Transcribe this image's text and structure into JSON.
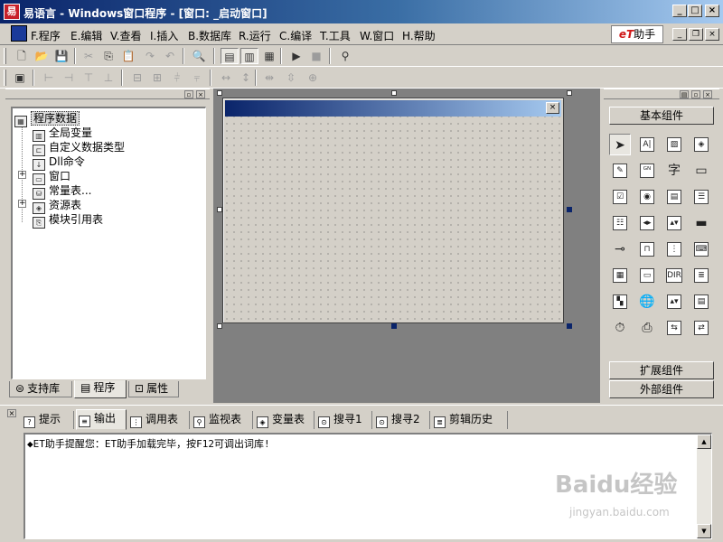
{
  "window": {
    "app_icon": "易",
    "title": "易语言 - Windows窗口程序 - [窗口: _启动窗口]",
    "controls": [
      "_",
      "□",
      "×"
    ]
  },
  "menubar": {
    "items": [
      "F.程序",
      "E.编辑",
      "V.查看",
      "I.插入",
      "B.数据库",
      "R.运行",
      "C.编译",
      "T.工具",
      "W.窗口",
      "H.帮助"
    ],
    "et_logo_prefix": "eT",
    "et_logo_text": "助手",
    "mdi_controls": [
      "_",
      "❐",
      "×"
    ]
  },
  "toolbar1": {
    "buttons": [
      {
        "icon": "new-file-icon",
        "glyph": "🗋",
        "state": "normal"
      },
      {
        "icon": "open-folder-icon",
        "glyph": "📂",
        "state": "normal"
      },
      {
        "icon": "save-icon",
        "glyph": "💾",
        "state": "normal"
      },
      {
        "icon": "cut-icon",
        "glyph": "✂",
        "state": "disabled"
      },
      {
        "icon": "copy-icon",
        "glyph": "⎘",
        "state": "normal"
      },
      {
        "icon": "paste-icon",
        "glyph": "📋",
        "state": "normal"
      },
      {
        "icon": "redo-icon",
        "glyph": "↷",
        "state": "disabled"
      },
      {
        "icon": "undo-icon",
        "glyph": "↶",
        "state": "disabled"
      },
      {
        "icon": "find-icon",
        "glyph": "🔍",
        "state": "normal"
      },
      {
        "icon": "layout-1-icon",
        "glyph": "▤",
        "state": "pressed"
      },
      {
        "icon": "layout-2-icon",
        "glyph": "▥",
        "state": "pressed"
      },
      {
        "icon": "layout-3-icon",
        "glyph": "▦",
        "state": "normal"
      },
      {
        "icon": "run-icon",
        "glyph": "▶",
        "state": "normal"
      },
      {
        "icon": "stop-icon",
        "glyph": "■",
        "state": "disabled"
      },
      {
        "icon": "binoculars-icon",
        "glyph": "⚲",
        "state": "normal"
      }
    ]
  },
  "toolbar2": {
    "buttons": [
      {
        "icon": "tab-order-icon",
        "glyph": "▣"
      },
      {
        "icon": "align-left-icon",
        "glyph": "⊢"
      },
      {
        "icon": "align-right-icon",
        "glyph": "⊣"
      },
      {
        "icon": "align-top-icon",
        "glyph": "⊤"
      },
      {
        "icon": "align-bottom-icon",
        "glyph": "⊥"
      },
      {
        "icon": "center-horizontal-icon",
        "glyph": "⊟"
      },
      {
        "icon": "center-vertical-icon",
        "glyph": "⊞"
      },
      {
        "icon": "space-across-icon",
        "glyph": "⫩"
      },
      {
        "icon": "space-down-icon",
        "glyph": "⫧"
      },
      {
        "icon": "same-width-icon",
        "glyph": "↔"
      },
      {
        "icon": "same-height-icon",
        "glyph": "↕"
      },
      {
        "icon": "make-same-width-icon",
        "glyph": "⇹"
      },
      {
        "icon": "make-same-height-icon",
        "glyph": "⇳"
      },
      {
        "icon": "center-in-form-icon",
        "glyph": "⊕"
      }
    ]
  },
  "left_panel": {
    "tree": {
      "root": "程序数据",
      "items": [
        {
          "label": "全局变量",
          "icon": "database-icon",
          "glyph": "▥",
          "expandable": false
        },
        {
          "label": "自定义数据类型",
          "icon": "custom-type-icon",
          "glyph": "⊏",
          "expandable": false
        },
        {
          "label": "Dll命令",
          "icon": "dll-command-icon",
          "glyph": "↓",
          "expandable": false
        },
        {
          "label": "窗口",
          "icon": "window-icon",
          "glyph": "▭",
          "expandable": true
        },
        {
          "label": "常量表...",
          "icon": "constant-table-icon",
          "glyph": "⛁",
          "expandable": false
        },
        {
          "label": "资源表",
          "icon": "resource-table-icon",
          "glyph": "◈",
          "expandable": true
        },
        {
          "label": "模块引用表",
          "icon": "module-reference-icon",
          "glyph": "⎘",
          "expandable": false
        }
      ]
    },
    "tabs": [
      {
        "label": "支持库",
        "icon": "library-icon",
        "glyph": "⊜",
        "active": false
      },
      {
        "label": "程序",
        "icon": "program-icon",
        "glyph": "▤",
        "active": true
      },
      {
        "label": "属性",
        "icon": "properties-icon",
        "glyph": "⊡",
        "active": false
      }
    ]
  },
  "designer": {
    "form_close": "×"
  },
  "toolbox": {
    "group_top": "基本组件",
    "group_ext": "扩展组件",
    "group_external": "外部组件",
    "tools": [
      {
        "name": "pointer-icon",
        "glyph": "➤",
        "plain": true,
        "selected": true
      },
      {
        "name": "label-icon",
        "glyph": "A|"
      },
      {
        "name": "picture-box-icon",
        "glyph": "▨"
      },
      {
        "name": "shape-icon",
        "glyph": "◈"
      },
      {
        "name": "edit-box-icon",
        "glyph": "✎"
      },
      {
        "name": "image-frame-icon",
        "glyph": "ᴳᴺ"
      },
      {
        "name": "text-label-icon",
        "glyph": "字",
        "plain": true
      },
      {
        "name": "button-icon",
        "glyph": "▭",
        "plain": true
      },
      {
        "name": "checkbox-icon",
        "glyph": "☑"
      },
      {
        "name": "radio-button-icon",
        "glyph": "◉"
      },
      {
        "name": "combo-box-icon",
        "glyph": "▤"
      },
      {
        "name": "list-box-icon",
        "glyph": "☰"
      },
      {
        "name": "checklist-box-icon",
        "glyph": "☷"
      },
      {
        "name": "horizontal-scrollbar-icon",
        "glyph": "◂▸"
      },
      {
        "name": "vertical-scrollbar-icon",
        "glyph": "▴▾"
      },
      {
        "name": "progress-bar-icon",
        "glyph": "▬",
        "plain": true
      },
      {
        "name": "slider-icon",
        "glyph": "⊸",
        "plain": true
      },
      {
        "name": "tab-control-icon",
        "glyph": "⊓"
      },
      {
        "name": "timer-control-icon",
        "glyph": "⋮"
      },
      {
        "name": "hotkey-icon",
        "glyph": "⌨"
      },
      {
        "name": "calendar-icon",
        "glyph": "▦"
      },
      {
        "name": "date-picker-icon",
        "glyph": "▭"
      },
      {
        "name": "drive-box-icon",
        "glyph": "DIR"
      },
      {
        "name": "file-box-icon",
        "glyph": "≣"
      },
      {
        "name": "color-picker-icon",
        "glyph": "▚"
      },
      {
        "name": "network-icon",
        "glyph": "🌐",
        "plain": true
      },
      {
        "name": "spin-icon",
        "glyph": "▴▾"
      },
      {
        "name": "grid-icon",
        "glyph": "▤"
      },
      {
        "name": "clock-icon",
        "glyph": "⏱",
        "plain": true
      },
      {
        "name": "printer-icon",
        "glyph": "⎙",
        "plain": true
      },
      {
        "name": "data-source-icon",
        "glyph": "⇆"
      },
      {
        "name": "data-provider-icon",
        "glyph": "⇄"
      }
    ]
  },
  "bottom_panel": {
    "close": "×",
    "tabs": [
      {
        "label": "提示",
        "icon": "hint-icon",
        "glyph": "?",
        "active": false
      },
      {
        "label": "输出",
        "icon": "output-icon",
        "glyph": "≡",
        "active": true
      },
      {
        "label": "调用表",
        "icon": "call-table-icon",
        "glyph": "⋮"
      },
      {
        "label": "监视表",
        "icon": "watch-icon",
        "glyph": "⚲"
      },
      {
        "label": "变量表",
        "icon": "variable-table-icon",
        "glyph": "◈"
      },
      {
        "label": "搜寻1",
        "icon": "search1-icon",
        "glyph": "⊙"
      },
      {
        "label": "搜寻2",
        "icon": "search2-icon",
        "glyph": "⊙"
      },
      {
        "label": "剪辑历史",
        "icon": "clip-history-icon",
        "glyph": "≣"
      }
    ],
    "output_text": "◆ET助手提醒您：ET助手加载完毕，按F12可调出词库!"
  },
  "watermark": {
    "brand": "Baidu经验",
    "url": "jingyan.baidu.com"
  }
}
